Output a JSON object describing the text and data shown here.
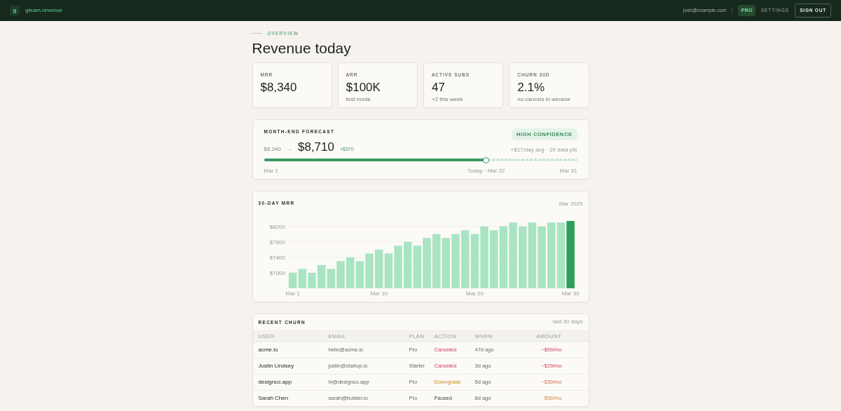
{
  "navbar": {
    "logo_letter": "g",
    "brand": "gleam.revenue",
    "email": "josh@example.com",
    "plan_badge": "PRO",
    "settings": "SETTINGS",
    "sign_out": "SIGN OUT"
  },
  "header": {
    "eyebrow": "OVERVIEW",
    "title": "Revenue today"
  },
  "kpis": [
    {
      "label": "MRR",
      "value": "$8,340"
    },
    {
      "label": "ARR",
      "value": "$100K",
      "note": "test mode"
    },
    {
      "label": "ACTIVE SUBS",
      "value": "47",
      "note": "+2 this week"
    },
    {
      "label": "CHURN 30D",
      "value": "2.1%",
      "note": "no cancels in window"
    }
  ],
  "forecast": {
    "title": "MONTH-END FORECAST",
    "badge": "HIGH CONFIDENCE",
    "detail": "+$17/day avg · 29 data pts",
    "current": "$8,340",
    "arrow": "→",
    "projected": "$8,710",
    "delta": "+$370",
    "level": 0.71,
    "start_label": "Mar 1",
    "today_label": "Today · Mar 22",
    "end_label": "Mar 31"
  },
  "mrr_chart": {
    "title": "30-DAY MRR",
    "period": "Mar 2025",
    "chart_data": {
      "type": "bar",
      "categories": [
        "Mar 1",
        null,
        null,
        null,
        null,
        null,
        null,
        null,
        null,
        "Mar 10",
        null,
        null,
        null,
        null,
        null,
        null,
        null,
        null,
        null,
        "Mar 20",
        null,
        null,
        null,
        null,
        null,
        null,
        null,
        null,
        null,
        "Mar 30"
      ],
      "grid": true,
      "ylim": [
        6600,
        8340
      ],
      "yticks": [
        {
          "value": 7000,
          "label": "$7000"
        },
        {
          "value": 7400,
          "label": "$7400"
        },
        {
          "value": 7800,
          "label": "$7800"
        },
        {
          "value": 8200,
          "label": "$8200"
        }
      ],
      "series": [
        {
          "color": "#a8e4c2",
          "values": [
            7000,
            7100,
            7000,
            7200,
            7100,
            7300,
            7400,
            7300,
            7500,
            7600,
            7500,
            7700,
            7800,
            7700,
            7900,
            8000,
            7900,
            8000,
            8100,
            8000,
            8200,
            8100,
            8200,
            8300,
            8200,
            8300,
            8200,
            8300,
            8300,
            null
          ]
        },
        {
          "color": "#2e9e5b",
          "values": [
            null,
            null,
            null,
            null,
            null,
            null,
            null,
            null,
            null,
            null,
            null,
            null,
            null,
            null,
            null,
            null,
            null,
            null,
            null,
            null,
            null,
            null,
            null,
            null,
            null,
            null,
            null,
            null,
            null,
            8340
          ]
        }
      ]
    }
  },
  "churn": {
    "title": "RECENT CHURN",
    "period": "last 30 days",
    "columns": [
      "USER",
      "EMAIL",
      "PLAN",
      "ACTION",
      "WHEN",
      "AMOUNT"
    ],
    "rows": [
      {
        "kind": "canceled",
        "user": "acme.io",
        "email": "hello@acme.io",
        "plan": "Pro",
        "action": "Canceled",
        "when": "47d ago",
        "amount": "−$99/mo"
      },
      {
        "kind": "canceled",
        "user": "Justin Lindsey",
        "email": "justin@startup.io",
        "plan": "Starter",
        "action": "Canceled",
        "when": "3d ago",
        "amount": "−$29/mo"
      },
      {
        "kind": "downgrade",
        "user": "designco.app",
        "email": "hi@designco.app",
        "plan": "Pro",
        "action": "Downgrade",
        "when": "5d ago",
        "amount": "−$30/mo"
      },
      {
        "kind": "paused",
        "user": "Sarah Chen",
        "email": "sarah@builder.io",
        "plan": "Pro",
        "action": "Paused",
        "when": "8d ago",
        "amount": "$58/mo"
      }
    ]
  }
}
